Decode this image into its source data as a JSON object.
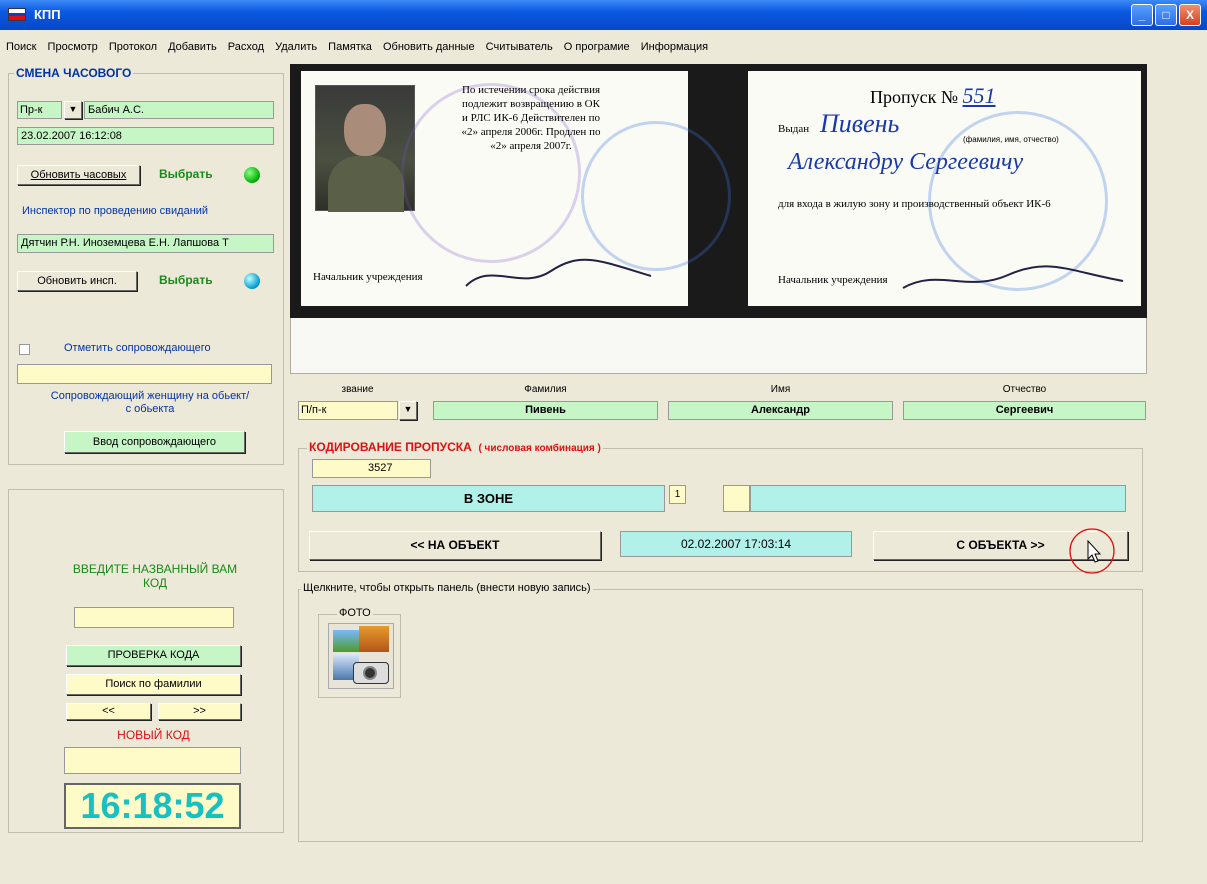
{
  "window": {
    "title": "КПП",
    "min": "_",
    "max": "□",
    "close": "X"
  },
  "menu": [
    "Поиск",
    "Просмотр",
    "Протокол",
    "Добавить",
    "Расход",
    "Удалить",
    "Памятка",
    "Обновить данные",
    "Считыватель",
    "О програмие",
    "Информация"
  ],
  "guard": {
    "title": "СМЕНА ЧАСОВОГО",
    "rank": "Пр-к",
    "name": "Бабич А.С.",
    "datetime": "23.02.2007 16:12:08",
    "update_btn": "Обновить часовых",
    "choose": "Выбрать",
    "inspector_label": "Инспектор по проведению свиданий",
    "inspectors": "Дятчин Р.Н. Иноземцева Е.Н. Лапшова Т",
    "update_insp_btn": "Обновить инсп.",
    "choose2": "Выбрать",
    "escort_check": "Отметить сопровождающего",
    "escort_note": "Сопровождающий женщину на обьект/ с обьекта",
    "escort_btn": "Ввод сопровождающего"
  },
  "code_panel": {
    "prompt": "ВВЕДИТЕ НАЗВАННЫЙ ВАМ КОД",
    "check_btn": "ПРОВЕРКА КОДА",
    "search_btn": "Поиск по фамилии",
    "prev": "<<",
    "next": ">>",
    "new_code": "НОВЫЙ КОД",
    "clock": "16:18:52"
  },
  "pass_card": {
    "left_text": "По истечении срока действия подлежит возвращению в ОК и РЛС ИК-6 Действителен по «2» апреля 2006г. Продлен по «2» апреля 2007г.",
    "left_bottom": "Начальник учреждения",
    "pass_no_label": "Пропуск №",
    "pass_no": "551",
    "issued_label": "Выдан",
    "issued_surname": "Пивень",
    "issued_sub": "(фамилия, имя, отчество)",
    "issued_names": "Александру Сергеевичу",
    "purpose": "для входа в жилую зону и производственный объект ИК-6",
    "right_bottom": "Начальник учреждения"
  },
  "person": {
    "rank_label": "звание",
    "rank": "П/п-к",
    "surname_label": "Фамилия",
    "surname": "Пивень",
    "name_label": "Имя",
    "name": "Александр",
    "patronymic_label": "Отчество",
    "patronymic": "Сергеевич"
  },
  "coding": {
    "title": "КОДИРОВАНИЕ ПРОПУСКА",
    "title_note": "( числовая комбинация )",
    "code": "3527",
    "status": "В ЗОНЕ",
    "count": "1",
    "to_object_btn": "<< НА ОБЪЕКТ",
    "timestamp": "02.02.2007 17:03:14",
    "from_object_btn": "С ОБЪЕКТА >>"
  },
  "records": {
    "title": "Щелкните, чтобы открыть панель (внести новую запись)",
    "photo_label": "ФОТО"
  },
  "colors": {
    "title_bar": "#0a58e0",
    "field_green": "#c6f5c6",
    "field_yellow": "#fffbc8",
    "field_cyan": "#b2f0ea",
    "accent_red": "#e01010",
    "clock_text": "#19c0c0"
  }
}
